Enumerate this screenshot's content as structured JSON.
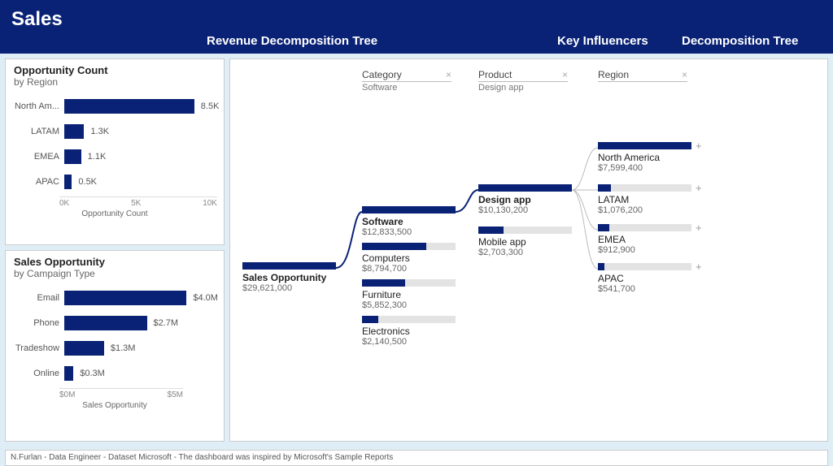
{
  "header": {
    "title": "Sales",
    "tab_center": "Revenue Decomposition Tree",
    "tab_influencers": "Key Influencers",
    "tab_decomp": "Decomposition Tree"
  },
  "panel_opportunity": {
    "title": "Opportunity Count",
    "subtitle": "by Region",
    "axis_label": "Opportunity Count",
    "ticks": [
      "0K",
      "5K",
      "10K"
    ]
  },
  "panel_sales": {
    "title": "Sales Opportunity",
    "subtitle": "by Campaign Type",
    "axis_label": "Sales Opportunity",
    "ticks": [
      "$0M",
      "$5M"
    ]
  },
  "breadcrumbs": {
    "c1": {
      "title": "Category",
      "value": "Software"
    },
    "c2": {
      "title": "Product",
      "value": "Design app"
    },
    "c3": {
      "title": "Region",
      "value": ""
    }
  },
  "tree": {
    "root": {
      "label": "Sales Opportunity",
      "value": "$29,621,000"
    },
    "cat": {
      "software": {
        "label": "Software",
        "value": "$12,833,500"
      },
      "computers": {
        "label": "Computers",
        "value": "$8,794,700"
      },
      "furniture": {
        "label": "Furniture",
        "value": "$5,852,300"
      },
      "electronics": {
        "label": "Electronics",
        "value": "$2,140,500"
      }
    },
    "prod": {
      "design": {
        "label": "Design app",
        "value": "$10,130,200"
      },
      "mobile": {
        "label": "Mobile app",
        "value": "$2,703,300"
      }
    },
    "region": {
      "na": {
        "label": "North America",
        "value": "$7,599,400"
      },
      "latam": {
        "label": "LATAM",
        "value": "$1,076,200"
      },
      "emea": {
        "label": "EMEA",
        "value": "$912,900"
      },
      "apac": {
        "label": "APAC",
        "value": "$541,700"
      }
    }
  },
  "footer": "N.Furlan - Data Engineer - Dataset Microsoft - The dashboard was inspired by Microsoft's Sample Reports",
  "chart_data": [
    {
      "type": "bar",
      "orientation": "horizontal",
      "title": "Opportunity Count by Region",
      "categories": [
        "North Am...",
        "LATAM",
        "EMEA",
        "APAC"
      ],
      "values": [
        8500,
        1300,
        1100,
        500
      ],
      "value_labels": [
        "8.5K",
        "1.3K",
        "1.1K",
        "0.5K"
      ],
      "xlabel": "Opportunity Count",
      "xlim": [
        0,
        10000
      ],
      "xticks": [
        "0K",
        "5K",
        "10K"
      ]
    },
    {
      "type": "bar",
      "orientation": "horizontal",
      "title": "Sales Opportunity by Campaign Type",
      "categories": [
        "Email",
        "Phone",
        "Tradeshow",
        "Online"
      ],
      "values": [
        4000000,
        2700000,
        1300000,
        300000
      ],
      "value_labels": [
        "$4.0M",
        "$2.7M",
        "$1.3M",
        "$0.3M"
      ],
      "xlabel": "Sales Opportunity",
      "xlim": [
        0,
        5000000
      ],
      "xticks": [
        "$0M",
        "$5M"
      ]
    },
    {
      "type": "tree",
      "title": "Revenue Decomposition Tree",
      "root": 29621000,
      "levels": [
        {
          "name": "Category",
          "selected": "Software",
          "items": [
            {
              "label": "Software",
              "value": 12833500
            },
            {
              "label": "Computers",
              "value": 8794700
            },
            {
              "label": "Furniture",
              "value": 5852300
            },
            {
              "label": "Electronics",
              "value": 2140500
            }
          ]
        },
        {
          "name": "Product",
          "selected": "Design app",
          "items": [
            {
              "label": "Design app",
              "value": 10130200
            },
            {
              "label": "Mobile app",
              "value": 2703300
            }
          ]
        },
        {
          "name": "Region",
          "items": [
            {
              "label": "North America",
              "value": 7599400
            },
            {
              "label": "LATAM",
              "value": 1076200
            },
            {
              "label": "EMEA",
              "value": 912900
            },
            {
              "label": "APAC",
              "value": 541700
            }
          ]
        }
      ]
    }
  ]
}
